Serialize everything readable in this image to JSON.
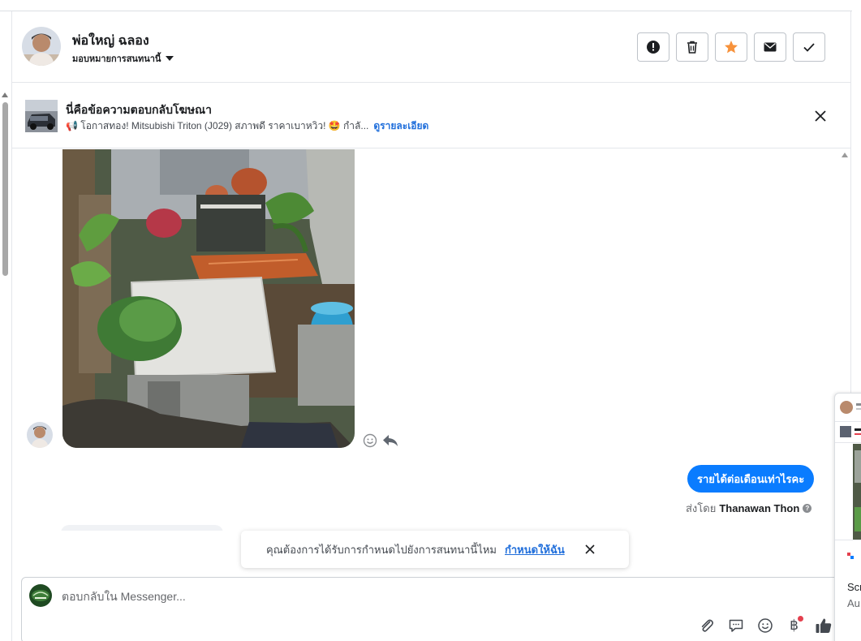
{
  "header": {
    "contact_name": "พ่อใหญ่ ฉลอง",
    "assign_label": "มอบหมายการสนทนานี้",
    "actions": [
      {
        "name": "spam-button",
        "icon": "exclamation-icon"
      },
      {
        "name": "delete-button",
        "icon": "trash-icon"
      },
      {
        "name": "star-button",
        "icon": "star-icon",
        "color": "#f7923b"
      },
      {
        "name": "mark-unread-button",
        "icon": "envelope-icon"
      },
      {
        "name": "mark-done-button",
        "icon": "check-icon"
      }
    ]
  },
  "ad_banner": {
    "title": "นี่คือข้อความตอบกลับโฆษณา",
    "text": "📢 โอกาสทอง! Mitsubishi Triton (J029) สภาพดี ราคาเบาหวิว! 🤩 กำลั...",
    "link": "ดูรายละเอียด"
  },
  "thread": {
    "outgoing_message": "รายได้ต่อเดือนเท่าไรคะ",
    "sent_by_label": "ส่งโดย",
    "sent_by_name": "Thanawan Thon"
  },
  "toast": {
    "text": "คุณต้องการได้รับการกำหนดไปยังการสนทนานี้ไหม",
    "link": "กำหนดให้ฉัน"
  },
  "composer": {
    "placeholder": "ตอบกลับใน Messenger...",
    "tools": [
      "paperclip-icon",
      "saved-reply-icon",
      "emoji-icon",
      "baht-payment-icon",
      "thumbs-up-icon"
    ]
  },
  "side_preview": {
    "text1": "Scr",
    "text2": "Au"
  },
  "colors": {
    "accent": "#0a7cff",
    "link": "#216fdb",
    "star": "#f7923b"
  }
}
